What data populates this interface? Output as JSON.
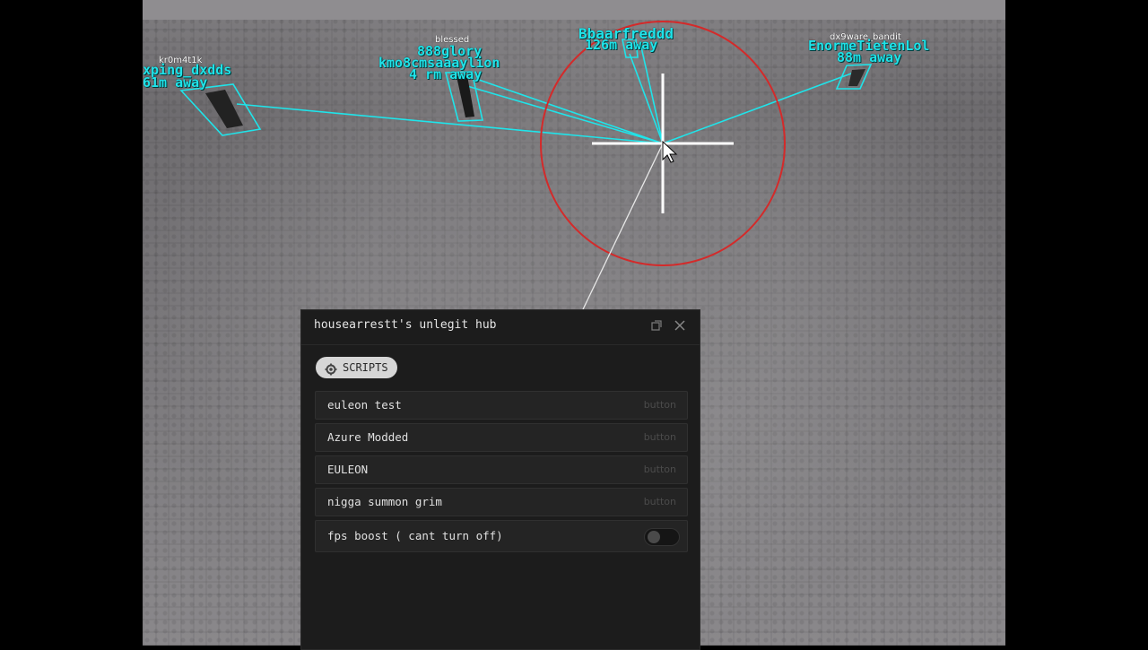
{
  "esp": {
    "players": [
      {
        "username": "kr0m4t1k",
        "display": "xping_dxdds",
        "distance": "61m away"
      },
      {
        "username": "blessed",
        "display": "888glory",
        "display2": "kmo8cmsaaaylion",
        "distance": "4 rm away"
      },
      {
        "username": "",
        "display": "Bbaarfreddd",
        "distance": "126m away"
      },
      {
        "username": "dx9ware_bandit",
        "display": "EnormeTietenLol",
        "distance": "88m away"
      }
    ],
    "esp_color": "#1fe4ea",
    "fov_circle_color": "#d42a2a",
    "crosshair_color": "#ffffff"
  },
  "hub": {
    "title": "housearrestt's unlegit hub",
    "tab": {
      "label": "SCRIPTS",
      "icon": "scripts-gear-icon"
    },
    "buttons": [
      {
        "label": "euleon test",
        "hint": "button"
      },
      {
        "label": "Azure Modded",
        "hint": "button"
      },
      {
        "label": "EULEON",
        "hint": "button"
      },
      {
        "label": "nigga summon grim",
        "hint": "button"
      }
    ],
    "toggle": {
      "label": "fps boost ( cant turn off)",
      "state": false
    }
  }
}
